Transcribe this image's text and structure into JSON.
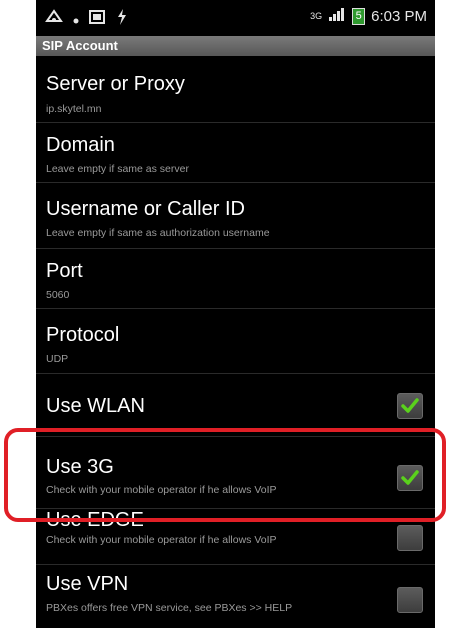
{
  "status_bar": {
    "network": "3G",
    "battery_label": "5",
    "time": "6:03 PM",
    "icons": [
      "android-usb-icon",
      "dot-icon",
      "sd-card-icon",
      "usb-debug-icon",
      "network-3g-icon",
      "signal-icon",
      "battery-icon"
    ]
  },
  "header": {
    "title": "SIP Account"
  },
  "settings": [
    {
      "title": "Server or Proxy",
      "summary": "ip.skytel.mn"
    },
    {
      "title": "Domain",
      "summary": "Leave empty if same as server"
    },
    {
      "title": "Username or Caller ID",
      "summary": "Leave empty if same as authorization username"
    },
    {
      "title": "Port",
      "summary": "5060"
    },
    {
      "title": "Protocol",
      "summary": "UDP"
    },
    {
      "title": "Use WLAN",
      "checked": true
    },
    {
      "title": "Use 3G",
      "summary": "Check with your mobile operator if he allows VoIP",
      "checked": true
    },
    {
      "title": "Use EDGE",
      "summary": "Check with your mobile operator if he allows VoIP",
      "checked": false
    },
    {
      "title": "Use VPN",
      "summary": "PBXes offers free VPN service, see PBXes >> HELP",
      "checked": false
    }
  ],
  "colors": {
    "background": "#000000",
    "title_bar": "#6b6b6b",
    "check_green": "#5ad11c",
    "highlight": "#e01f26"
  }
}
